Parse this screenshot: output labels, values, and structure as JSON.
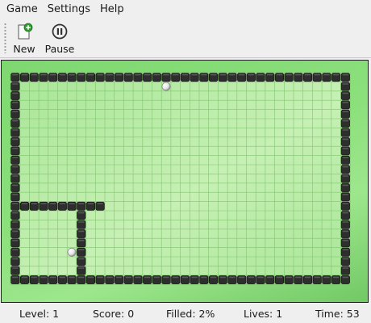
{
  "menubar": {
    "items": [
      {
        "label": "Game"
      },
      {
        "label": "Settings"
      },
      {
        "label": "Help"
      }
    ]
  },
  "toolbar": {
    "new_label": "New",
    "pause_label": "Pause"
  },
  "game": {
    "grid_cols": 36,
    "grid_rows": 23,
    "colors": {
      "field": "#a8e696",
      "field_light": "#c6f0b4",
      "grid_line": "#7dbf6c",
      "wall": "#2e2e2e",
      "wall_highlight": "#6a6a6a",
      "frame_outer": "#5fb850"
    },
    "walls": {
      "border": true,
      "filled_segments": [
        {
          "orientation": "horizontal",
          "row": 14,
          "col_start": 1,
          "col_end": 9
        },
        {
          "orientation": "vertical",
          "col": 7,
          "row_start": 15,
          "row_end": 21
        }
      ]
    },
    "balls": [
      {
        "col": 16,
        "row": 1
      },
      {
        "col": 6,
        "row": 19
      }
    ]
  },
  "status": {
    "level": "Level: 1",
    "score": "Score: 0",
    "filled": "Filled: 2%",
    "lives": "Lives: 1",
    "time": "Time: 53"
  }
}
